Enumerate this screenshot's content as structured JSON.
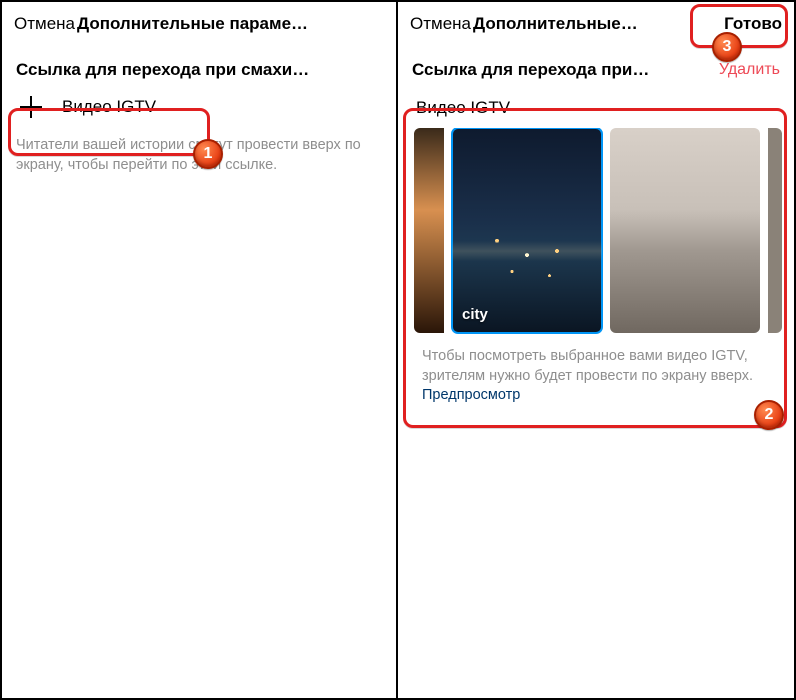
{
  "left": {
    "cancel": "Отмена",
    "title": "Дополнительные параме…",
    "section": "Ссылка для перехода при смахи…",
    "addLabel": "Видео IGTV",
    "hint": "Читатели вашей истории смогут провести вверх по экрану, чтобы перейти по этой ссылке."
  },
  "right": {
    "cancel": "Отмена",
    "title": "Дополнительные…",
    "done": "Готово",
    "section": "Ссылка для перехода при…",
    "delete": "Удалить",
    "panelTitle": "Видео IGTV",
    "selectedCaption": "city",
    "hint": "Чтобы посмотреть выбранное вами видео IGTV, зрителям нужно будет провести по экрану вверх. ",
    "preview": "Предпросмотр"
  },
  "badges": {
    "b1": "1",
    "b2": "2",
    "b3": "3"
  }
}
